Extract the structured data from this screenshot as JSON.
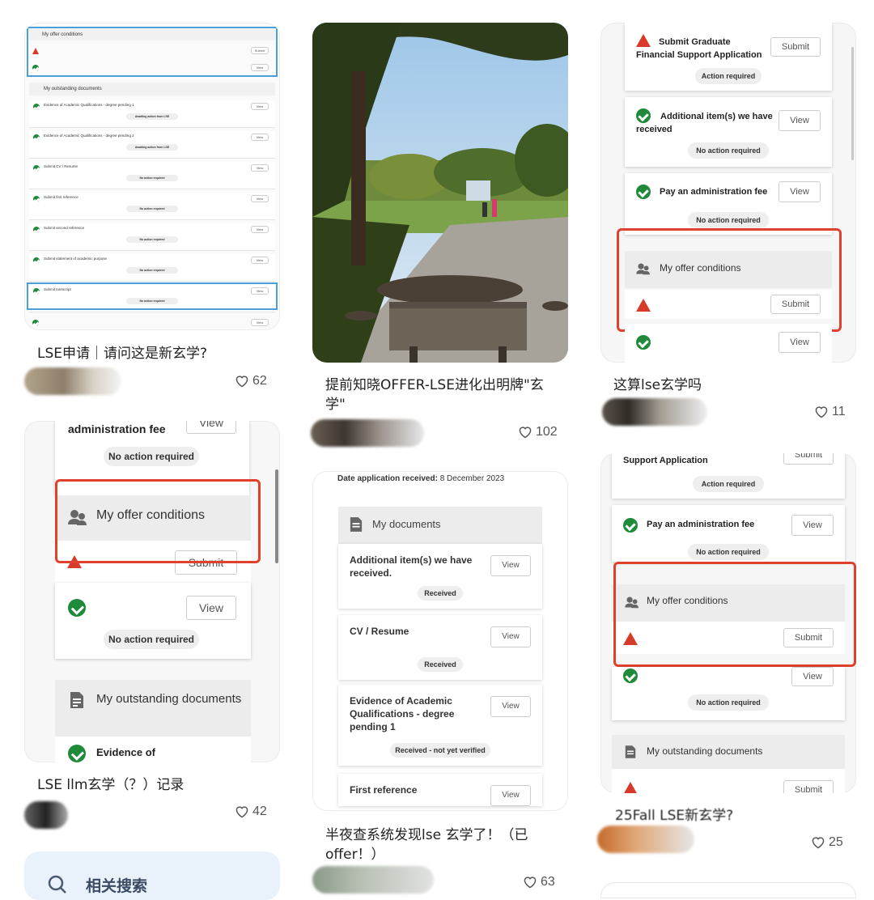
{
  "posts": [
    {
      "title": "LSE申请｜请问这是新玄学?",
      "likes": "62"
    },
    {
      "title": "提前知晓OFFER-LSE进化出明牌\"玄学\"",
      "likes": "102"
    },
    {
      "title": "这算lse玄学吗",
      "likes": "11"
    },
    {
      "title": "LSE llm玄学（？）记录",
      "likes": "42"
    },
    {
      "title": "半夜查系统发现lse 玄学了！（已offer！）",
      "likes": "63"
    },
    {
      "title": "25Fall LSE新玄学?",
      "likes": "25"
    }
  ],
  "card1": {
    "offer_header": "My offer conditions",
    "submit": "Submit",
    "view": "View",
    "outstanding_header": "My outstanding documents",
    "rows": [
      {
        "label": "Evidence of Academic Qualifications - degree pending 1",
        "status": "Awaiting action from LSE"
      },
      {
        "label": "Evidence of Academic Qualifications - degree pending 2",
        "status": "Awaiting action from LSE"
      },
      {
        "label": "Submit CV / Resume",
        "status": "No action required"
      },
      {
        "label": "Submit first reference",
        "status": "No action required"
      },
      {
        "label": "Submit second reference",
        "status": "No action required"
      },
      {
        "label": "Submit statement of academic purpose",
        "status": "No action required"
      },
      {
        "label": "Submit transcript",
        "status": "No action required"
      }
    ]
  },
  "card3": {
    "item1": "Submit Graduate Financial Support Application",
    "item1_status": "Action required",
    "submit": "Submit",
    "item2": "Additional item(s) we have received",
    "item2_status": "No action required",
    "view": "View",
    "item3": "Pay an administration fee",
    "item3_status": "No action required",
    "offer": "My offer conditions"
  },
  "card4": {
    "top_label": "administration fee",
    "top_btn": "View",
    "status": "No action required",
    "offer": "My offer conditions",
    "submit": "Submit",
    "view": "View",
    "outstanding": "My outstanding documents",
    "evidence": "Evidence of"
  },
  "card5": {
    "date_label": "Date application received:",
    "date_value": "8 December 2023",
    "docs_header": "My documents",
    "view": "View",
    "items": [
      {
        "label": "Additional item(s) we have received.",
        "status": "Received"
      },
      {
        "label": "CV / Resume",
        "status": "Received"
      },
      {
        "label": "Evidence of Academic Qualifications - degree pending 1",
        "status": "Received - not yet verified"
      },
      {
        "label": "First reference",
        "status": ""
      }
    ]
  },
  "card6": {
    "top": "Support Application",
    "top_btn": "Submit",
    "top_status": "Action required",
    "pay": "Pay an administration fee",
    "view": "View",
    "no_action": "No action required",
    "offer": "My offer conditions",
    "submit": "Submit",
    "outstanding": "My outstanding documents"
  },
  "related_search": "相关搜索",
  "colors": {
    "accent_red": "#e0412f",
    "check_green": "#1e8a3a",
    "warn_red": "#d83a2a"
  }
}
